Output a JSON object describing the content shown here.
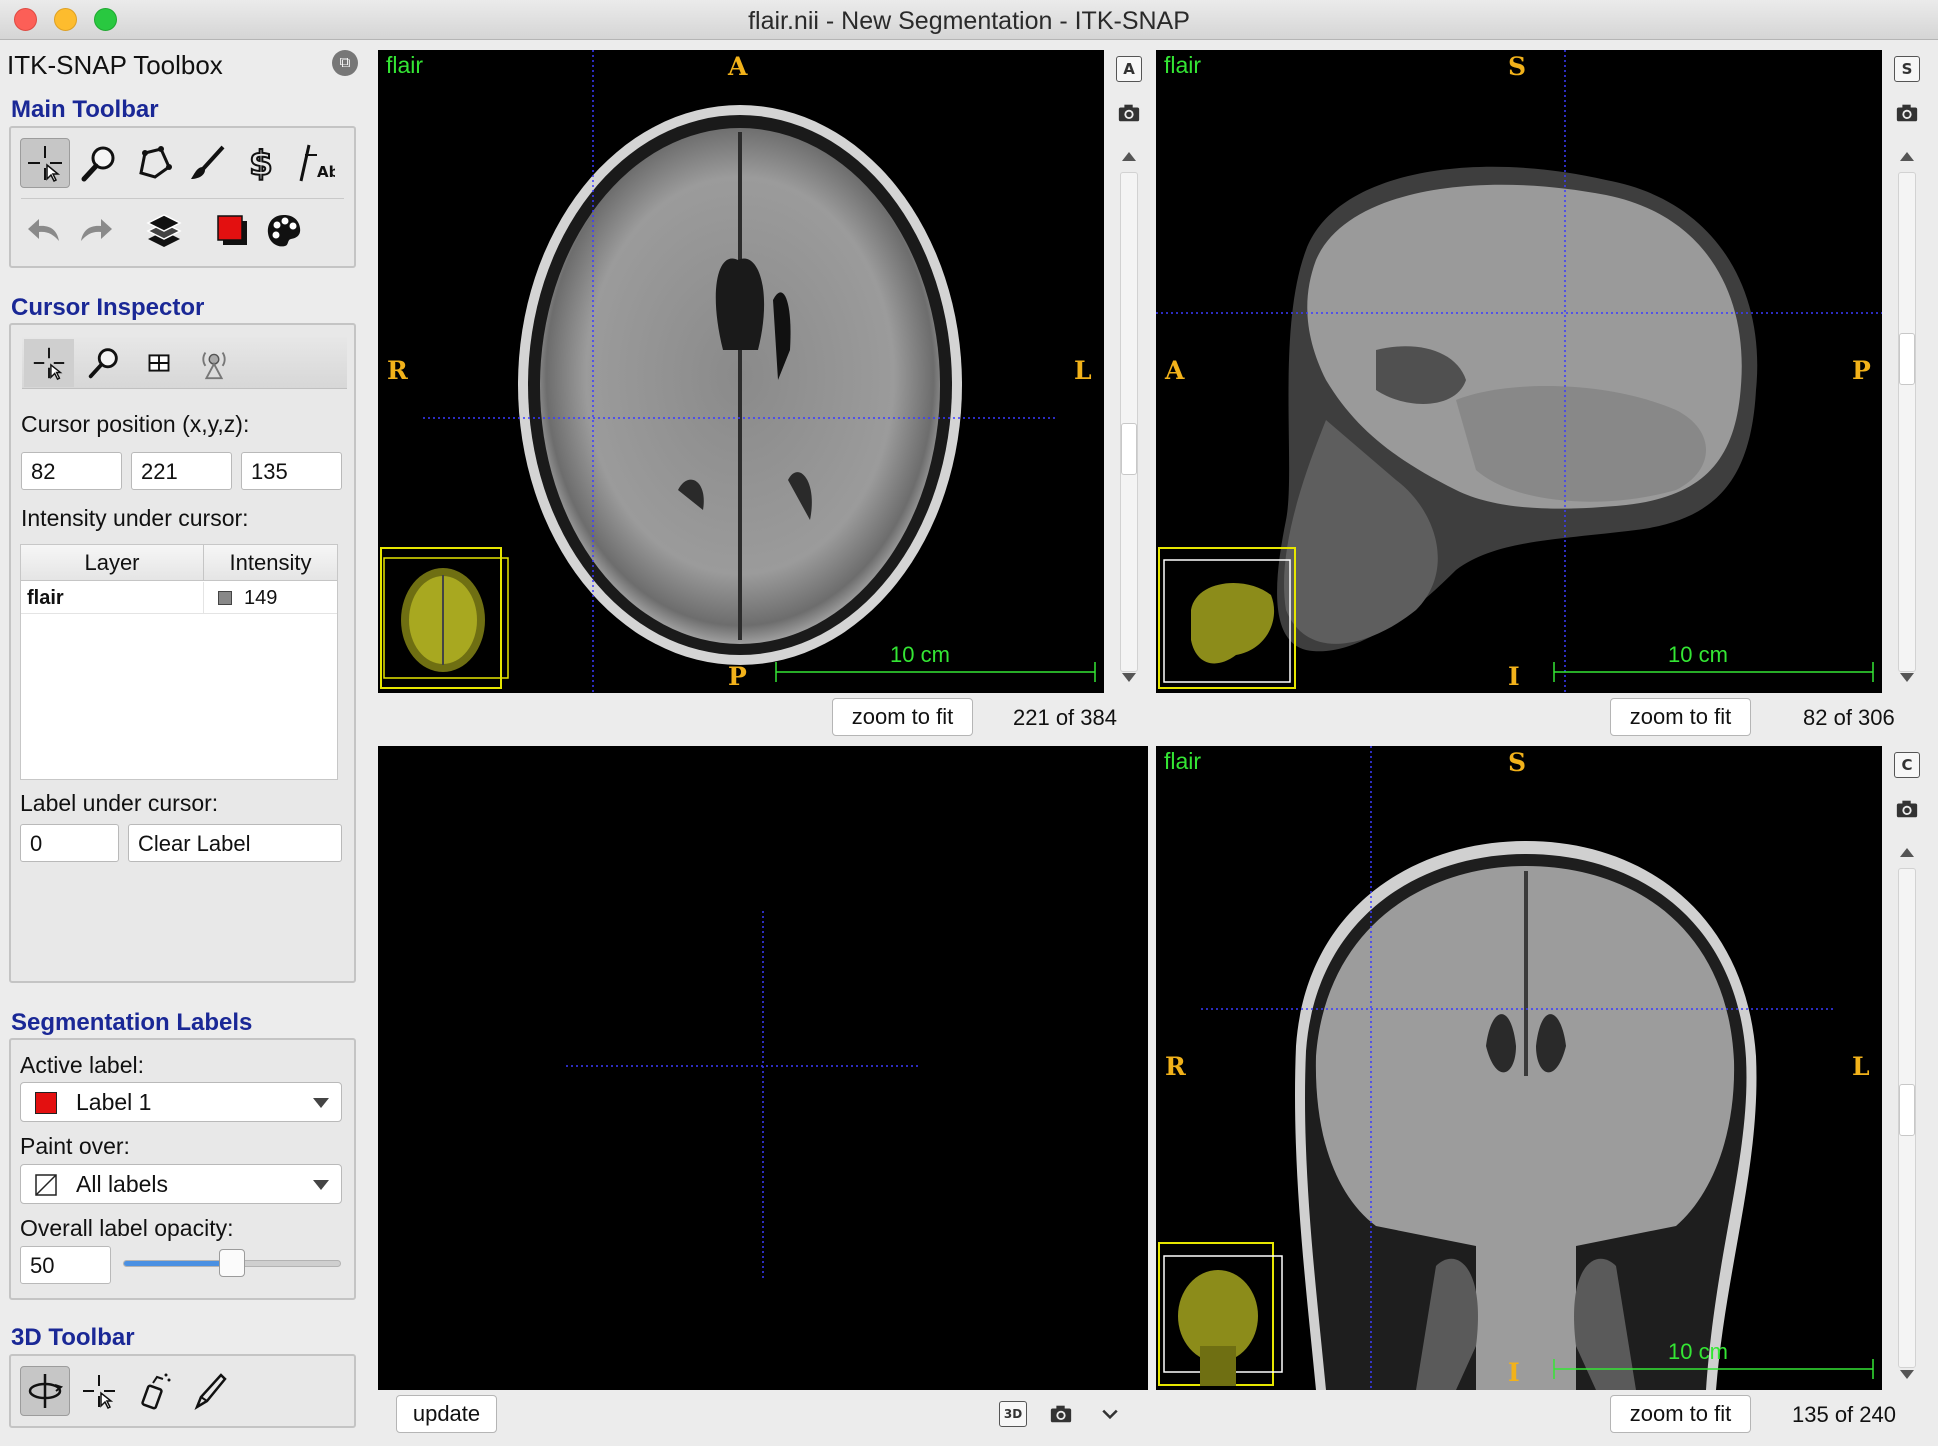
{
  "window": {
    "title": "flair.nii - New Segmentation - ITK-SNAP"
  },
  "toolbox": {
    "title": "ITK-SNAP Toolbox",
    "main_toolbar": {
      "title": "Main Toolbar",
      "tools": [
        "crosshair-cursor-icon",
        "zoom-icon",
        "polygon-icon",
        "paintbrush-icon",
        "snake-icon",
        "annotation-icon"
      ],
      "actions": [
        "undo-icon",
        "redo-icon",
        "layers-icon",
        "label-color-icon",
        "palette-icon"
      ],
      "active_tool": "crosshair-cursor-icon"
    },
    "cursor_inspector": {
      "title": "Cursor Inspector",
      "position_label": "Cursor position (x,y,z):",
      "x": "82",
      "y": "221",
      "z": "135",
      "intensity_label": "Intensity under cursor:",
      "table_headers": [
        "Layer",
        "Intensity"
      ],
      "rows": [
        {
          "layer": "flair",
          "intensity": "149"
        }
      ],
      "label_under_cursor": "Label under cursor:",
      "label_id": "0",
      "label_name": "Clear Label"
    },
    "segmentation_labels": {
      "title": "Segmentation Labels",
      "active_label_caption": "Active label:",
      "active_label": "Label 1",
      "active_label_color": "#e31010",
      "paint_over_caption": "Paint over:",
      "paint_over": "All labels",
      "opacity_caption": "Overall label opacity:",
      "opacity": "50",
      "opacity_fraction": 0.5
    },
    "toolbar_3d": {
      "title": "3D Toolbar"
    }
  },
  "views": {
    "axial": {
      "layer": "flair",
      "top": "A",
      "bottom": "P",
      "left": "R",
      "right": "L",
      "scale": "10 cm",
      "zoom": "zoom to fit",
      "slice": "221 of 384",
      "btn_letter": "A"
    },
    "sagittal": {
      "layer": "flair",
      "top": "S",
      "bottom": "I",
      "left": "A",
      "right": "P",
      "scale": "10 cm",
      "zoom": "zoom to fit",
      "slice": "82 of 306",
      "btn_letter": "S"
    },
    "coronal": {
      "layer": "flair",
      "top": "S",
      "bottom": "I",
      "left": "R",
      "right": "L",
      "scale": "10 cm",
      "zoom": "zoom to fit",
      "slice": "135 of 240",
      "btn_letter": "C"
    },
    "three_d": {
      "update": "update",
      "btn_3d": "3D"
    }
  },
  "colors": {
    "orientation": "#f2b21a",
    "overlay_text": "#34e634",
    "crosshair": "#3b3bff",
    "thumbnail_frame": "#e6e600"
  }
}
